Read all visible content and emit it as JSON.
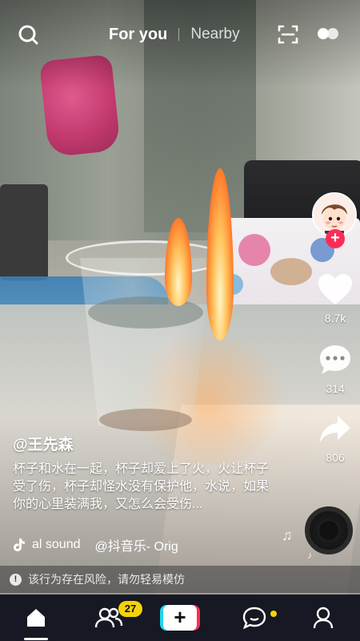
{
  "top_bar": {
    "tabs": [
      {
        "label": "For you",
        "active": true
      },
      {
        "label": "Nearby",
        "active": false
      }
    ],
    "icons": [
      "search-icon",
      "scan-icon",
      "live-icon"
    ]
  },
  "video": {
    "author_handle": "@王先森",
    "description": "杯子和水在一起，杯子却爱上了火，火让杯子受了伤，杯子却怪水没有保护他，水说，如果你的心里装满我，又怎么会受伤...",
    "music": {
      "original_sound": "al sound",
      "source": "@抖音乐- Orig"
    }
  },
  "actions": {
    "likes": "8.7k",
    "comments": "314",
    "shares": "806"
  },
  "risk_warning": {
    "text": "该行为存在风险，请勿轻易模仿"
  },
  "bottom_nav": {
    "friends_badge": "27",
    "create_label": "+",
    "items": [
      "home-icon",
      "friends-icon",
      "create-button",
      "inbox-icon",
      "profile-icon"
    ]
  },
  "colors": {
    "accent_red": "#fe2c55",
    "accent_cyan": "#20d5ec",
    "badge_yellow": "#f4d20b",
    "nav_background": "#161823"
  }
}
